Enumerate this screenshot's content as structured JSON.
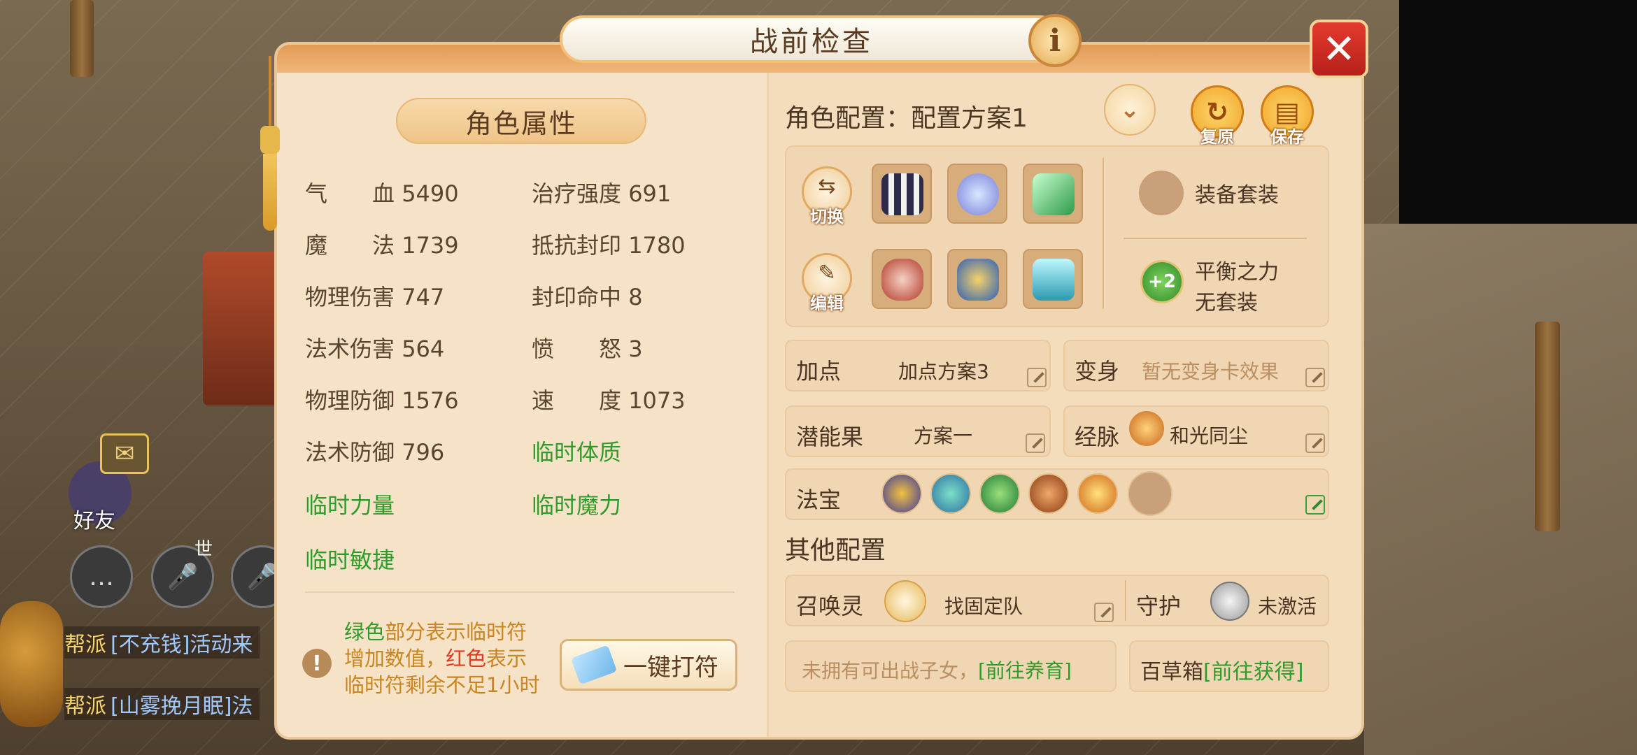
{
  "dialog": {
    "title": "战前检查",
    "info_glyph": "i",
    "close_glyph": "✕"
  },
  "hud": {
    "friend_label": "好友",
    "shi_label": "世",
    "chat": [
      {
        "tag": "帮派",
        "text": "[不充钱]活动来"
      },
      {
        "tag": "帮派",
        "text": "[山雾挽月眠]法"
      }
    ]
  },
  "attributes": {
    "header": "角色属性",
    "left": [
      {
        "label": "气　　血",
        "value": "5490"
      },
      {
        "label": "魔　　法",
        "value": "1739"
      },
      {
        "label": "物理伤害",
        "value": "747"
      },
      {
        "label": "法术伤害",
        "value": "564"
      },
      {
        "label": "物理防御",
        "value": "1576"
      },
      {
        "label": "法术防御",
        "value": "796"
      },
      {
        "label": "临时力量",
        "value": "",
        "green": true
      },
      {
        "label": "临时敏捷",
        "value": "",
        "green": true
      }
    ],
    "right": [
      {
        "label": "治疗强度",
        "value": "691"
      },
      {
        "label": "抵抗封印",
        "value": "1780"
      },
      {
        "label": "封印命中",
        "value": "8"
      },
      {
        "label": "愤　　怒",
        "value": "3"
      },
      {
        "label": "速　　度",
        "value": "1073"
      },
      {
        "label": "临时体质",
        "value": "",
        "green": true
      },
      {
        "label": "临时魔力",
        "value": "",
        "green": true
      }
    ],
    "note": {
      "line1_green": "绿色",
      "line1_rest": "部分表示临时符",
      "line2_a": "增加数值，",
      "line2_red": "红色",
      "line2_b": "表示",
      "line3": "临时符剩余不足1小时"
    },
    "onekey_label": "一键打符"
  },
  "config": {
    "title": "角色配置：配置方案1",
    "restore_label": "复原",
    "save_label": "保存",
    "switch_label": "切换",
    "edit_label": "编辑",
    "equip_set_label": "装备套装",
    "balance_badge": "+2",
    "balance_name": "平衡之力",
    "balance_status": "无套装",
    "addpoint_label": "加点",
    "addpoint_value": "加点方案3",
    "transform_label": "变身",
    "transform_value": "暂无变身卡效果",
    "potential_label": "潜能果",
    "potential_value": "方案一",
    "meridian_label": "经脉",
    "meridian_value": "和光同尘",
    "treasure_label": "法宝",
    "treasure_icons": [
      "treasure-warrior-icon",
      "treasure-dragon-icon",
      "treasure-gourd-icon",
      "treasure-bell-icon",
      "treasure-fan-icon"
    ]
  },
  "other": {
    "title": "其他配置",
    "summon_label": "召唤灵",
    "summon_value": "找固定队",
    "guard_label": "守护",
    "guard_value": "未激活",
    "children_text": "未拥有可出战子女，",
    "children_link": "[前往养育]",
    "herb_label": "百草箱",
    "herb_link": "[前往获得]"
  },
  "colors": {
    "accent_green": "#2e9b2a",
    "accent_red": "#e23a23",
    "close_red": "#d62b21",
    "panel_bg": "#f6e3c7"
  }
}
